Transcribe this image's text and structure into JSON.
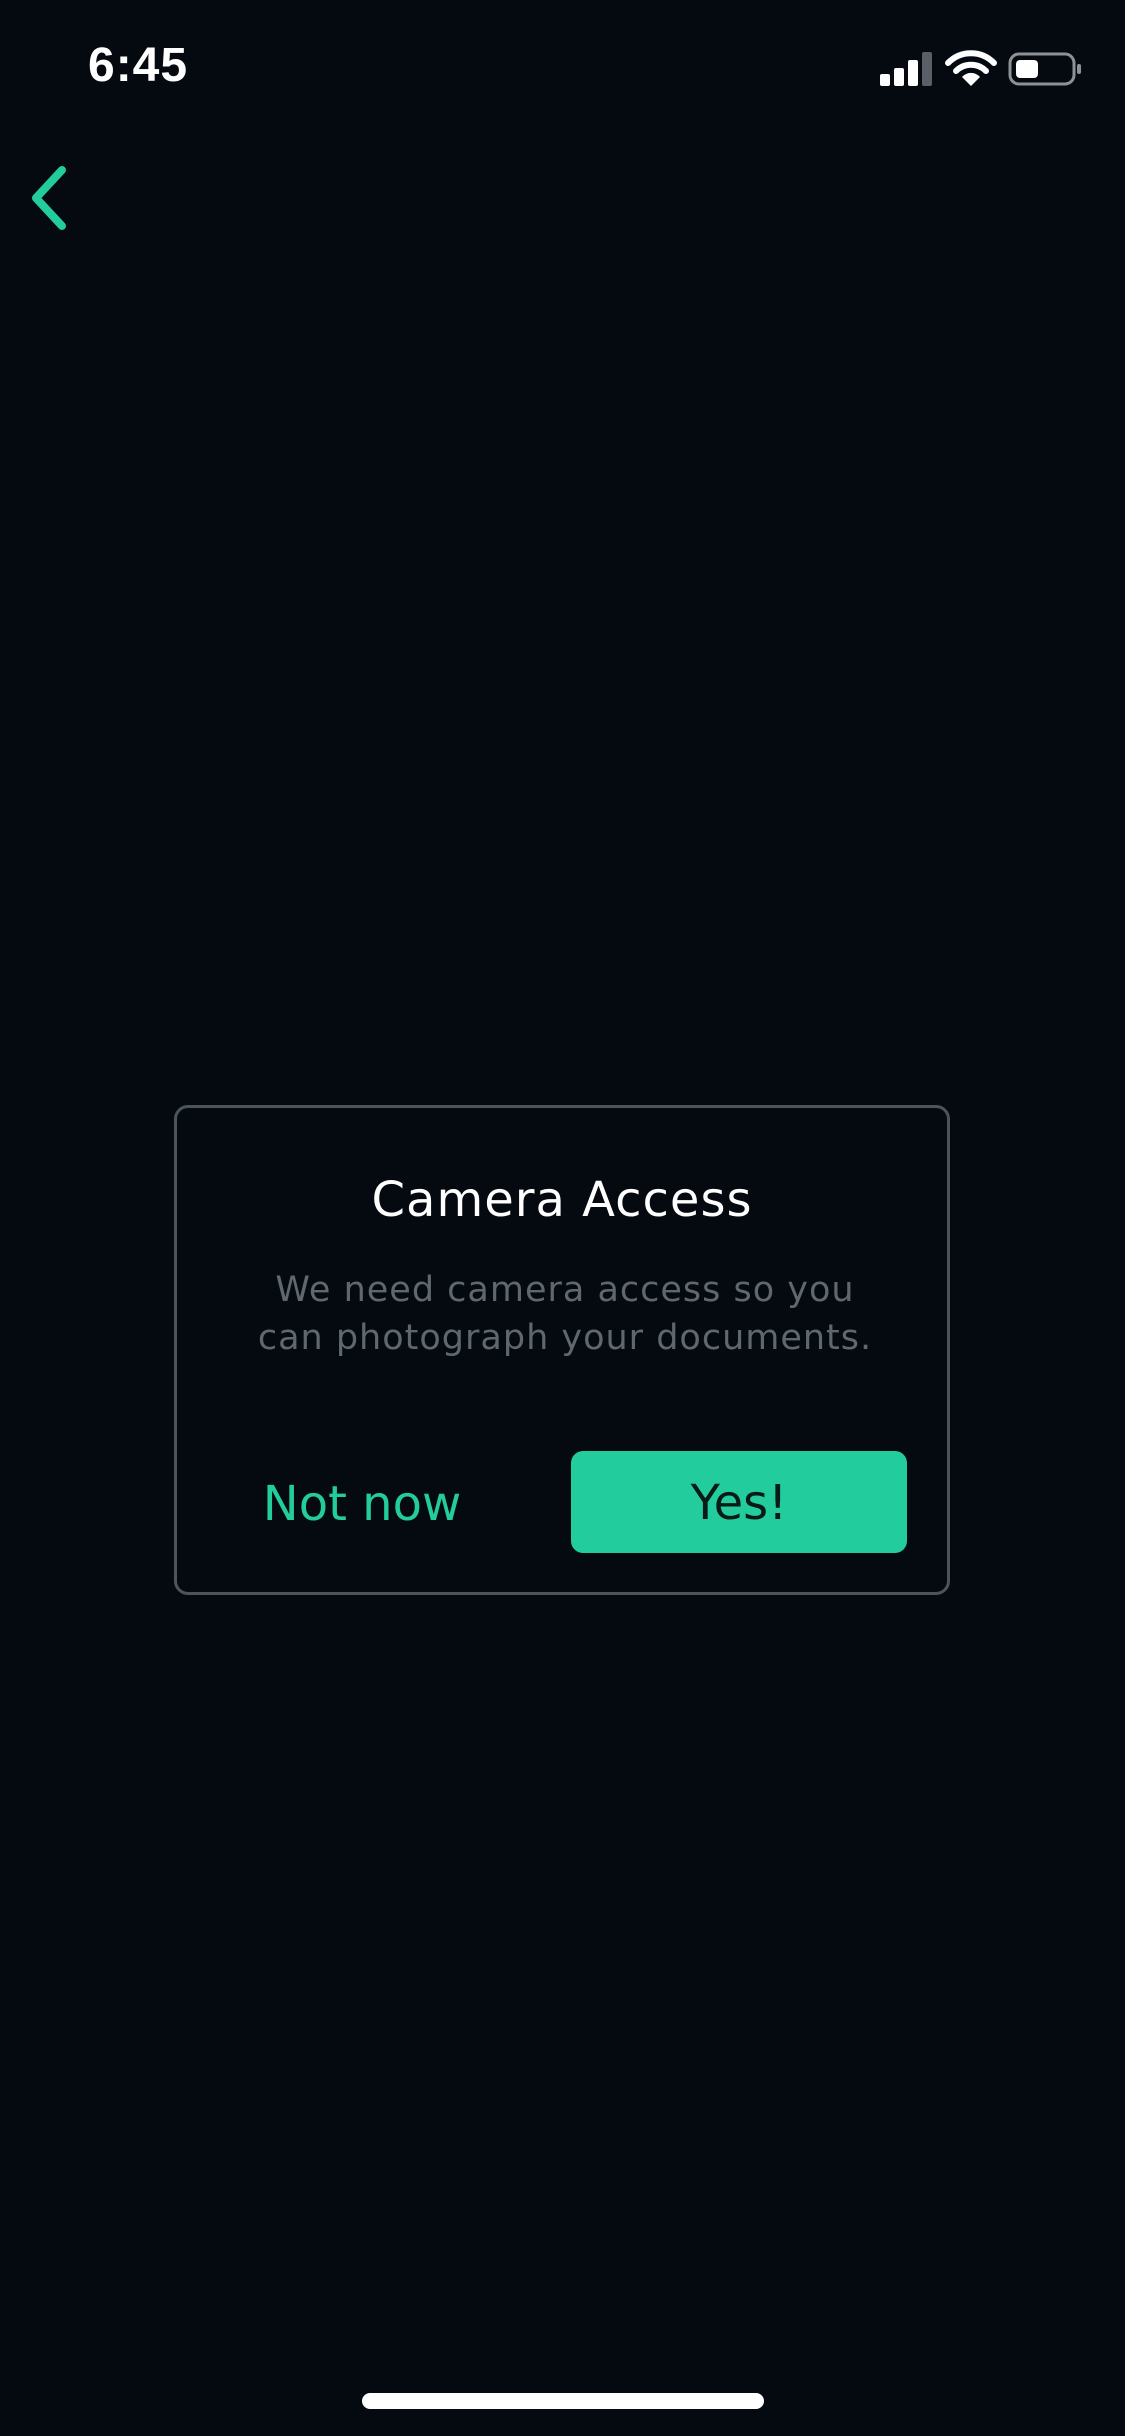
{
  "status_bar": {
    "time": "6:45",
    "icons": [
      "cellular-signal-icon",
      "wifi-icon",
      "battery-icon"
    ],
    "battery_level": 0.4
  },
  "nav": {
    "back_icon": "chevron-left-icon"
  },
  "dialog": {
    "title": "Camera Access",
    "message": "We need camera access so you can photograph your documents.",
    "secondary_label": "Not now",
    "primary_label": "Yes!"
  },
  "colors": {
    "background": "#050a10",
    "accent": "#22cc9d",
    "border": "#4b545c",
    "muted_text": "#5f686f",
    "text": "#ffffff"
  }
}
